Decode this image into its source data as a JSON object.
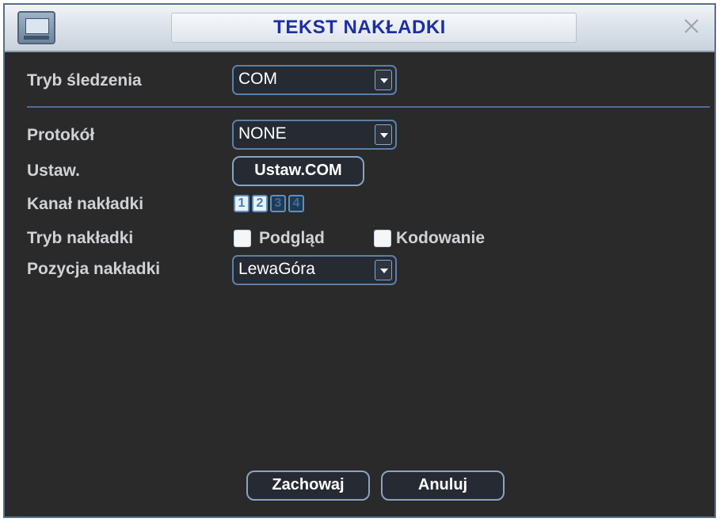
{
  "window": {
    "title": "TEKST NAKŁADKI"
  },
  "form": {
    "tracking_mode": {
      "label": "Tryb śledzenia",
      "value": "COM"
    },
    "protocol": {
      "label": "Protokół",
      "value": "NONE"
    },
    "settings": {
      "label": "Ustaw.",
      "button": "Ustaw.COM"
    },
    "overlay_channel": {
      "label": "Kanał nakładki",
      "channels": [
        {
          "number": "1",
          "selected": true
        },
        {
          "number": "2",
          "selected": true
        },
        {
          "number": "3",
          "selected": false
        },
        {
          "number": "4",
          "selected": false
        }
      ]
    },
    "overlay_mode": {
      "label": "Tryb nakładki",
      "options": [
        {
          "label": "Podgląd",
          "checked": false
        },
        {
          "label": "Kodowanie",
          "checked": false
        }
      ]
    },
    "overlay_position": {
      "label": "Pozycja nakładki",
      "value": "LewaGóra"
    }
  },
  "buttons": {
    "save": "Zachowaj",
    "cancel": "Anuluj"
  },
  "icons": {
    "app": "monitor-icon",
    "close": "close-icon",
    "dropdown": "chevron-down-icon"
  }
}
